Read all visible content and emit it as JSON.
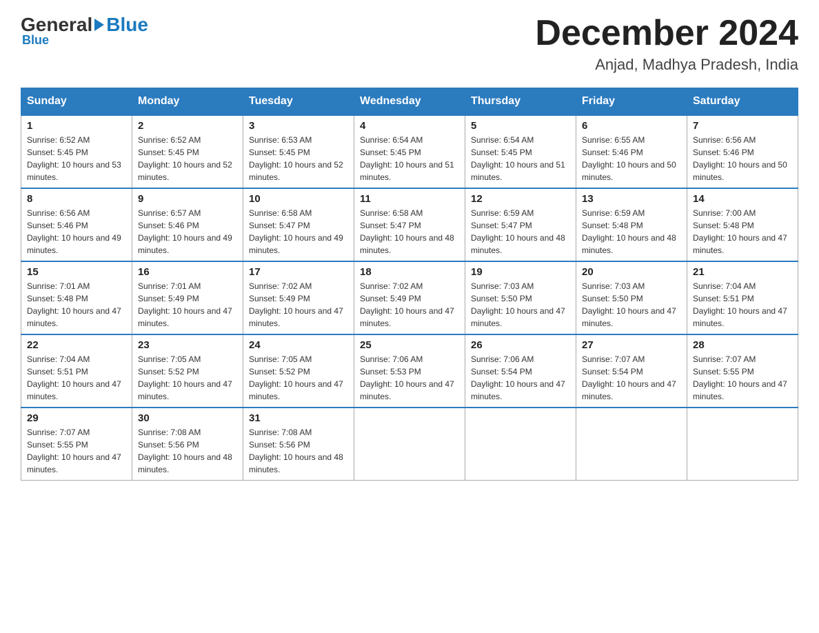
{
  "header": {
    "logo_general": "General",
    "logo_blue": "Blue",
    "calendar_title": "December 2024",
    "calendar_subtitle": "Anjad, Madhya Pradesh, India"
  },
  "weekdays": [
    "Sunday",
    "Monday",
    "Tuesday",
    "Wednesday",
    "Thursday",
    "Friday",
    "Saturday"
  ],
  "weeks": [
    [
      {
        "day": "1",
        "sunrise": "6:52 AM",
        "sunset": "5:45 PM",
        "daylight": "10 hours and 53 minutes."
      },
      {
        "day": "2",
        "sunrise": "6:52 AM",
        "sunset": "5:45 PM",
        "daylight": "10 hours and 52 minutes."
      },
      {
        "day": "3",
        "sunrise": "6:53 AM",
        "sunset": "5:45 PM",
        "daylight": "10 hours and 52 minutes."
      },
      {
        "day": "4",
        "sunrise": "6:54 AM",
        "sunset": "5:45 PM",
        "daylight": "10 hours and 51 minutes."
      },
      {
        "day": "5",
        "sunrise": "6:54 AM",
        "sunset": "5:45 PM",
        "daylight": "10 hours and 51 minutes."
      },
      {
        "day": "6",
        "sunrise": "6:55 AM",
        "sunset": "5:46 PM",
        "daylight": "10 hours and 50 minutes."
      },
      {
        "day": "7",
        "sunrise": "6:56 AM",
        "sunset": "5:46 PM",
        "daylight": "10 hours and 50 minutes."
      }
    ],
    [
      {
        "day": "8",
        "sunrise": "6:56 AM",
        "sunset": "5:46 PM",
        "daylight": "10 hours and 49 minutes."
      },
      {
        "day": "9",
        "sunrise": "6:57 AM",
        "sunset": "5:46 PM",
        "daylight": "10 hours and 49 minutes."
      },
      {
        "day": "10",
        "sunrise": "6:58 AM",
        "sunset": "5:47 PM",
        "daylight": "10 hours and 49 minutes."
      },
      {
        "day": "11",
        "sunrise": "6:58 AM",
        "sunset": "5:47 PM",
        "daylight": "10 hours and 48 minutes."
      },
      {
        "day": "12",
        "sunrise": "6:59 AM",
        "sunset": "5:47 PM",
        "daylight": "10 hours and 48 minutes."
      },
      {
        "day": "13",
        "sunrise": "6:59 AM",
        "sunset": "5:48 PM",
        "daylight": "10 hours and 48 minutes."
      },
      {
        "day": "14",
        "sunrise": "7:00 AM",
        "sunset": "5:48 PM",
        "daylight": "10 hours and 47 minutes."
      }
    ],
    [
      {
        "day": "15",
        "sunrise": "7:01 AM",
        "sunset": "5:48 PM",
        "daylight": "10 hours and 47 minutes."
      },
      {
        "day": "16",
        "sunrise": "7:01 AM",
        "sunset": "5:49 PM",
        "daylight": "10 hours and 47 minutes."
      },
      {
        "day": "17",
        "sunrise": "7:02 AM",
        "sunset": "5:49 PM",
        "daylight": "10 hours and 47 minutes."
      },
      {
        "day": "18",
        "sunrise": "7:02 AM",
        "sunset": "5:49 PM",
        "daylight": "10 hours and 47 minutes."
      },
      {
        "day": "19",
        "sunrise": "7:03 AM",
        "sunset": "5:50 PM",
        "daylight": "10 hours and 47 minutes."
      },
      {
        "day": "20",
        "sunrise": "7:03 AM",
        "sunset": "5:50 PM",
        "daylight": "10 hours and 47 minutes."
      },
      {
        "day": "21",
        "sunrise": "7:04 AM",
        "sunset": "5:51 PM",
        "daylight": "10 hours and 47 minutes."
      }
    ],
    [
      {
        "day": "22",
        "sunrise": "7:04 AM",
        "sunset": "5:51 PM",
        "daylight": "10 hours and 47 minutes."
      },
      {
        "day": "23",
        "sunrise": "7:05 AM",
        "sunset": "5:52 PM",
        "daylight": "10 hours and 47 minutes."
      },
      {
        "day": "24",
        "sunrise": "7:05 AM",
        "sunset": "5:52 PM",
        "daylight": "10 hours and 47 minutes."
      },
      {
        "day": "25",
        "sunrise": "7:06 AM",
        "sunset": "5:53 PM",
        "daylight": "10 hours and 47 minutes."
      },
      {
        "day": "26",
        "sunrise": "7:06 AM",
        "sunset": "5:54 PM",
        "daylight": "10 hours and 47 minutes."
      },
      {
        "day": "27",
        "sunrise": "7:07 AM",
        "sunset": "5:54 PM",
        "daylight": "10 hours and 47 minutes."
      },
      {
        "day": "28",
        "sunrise": "7:07 AM",
        "sunset": "5:55 PM",
        "daylight": "10 hours and 47 minutes."
      }
    ],
    [
      {
        "day": "29",
        "sunrise": "7:07 AM",
        "sunset": "5:55 PM",
        "daylight": "10 hours and 47 minutes."
      },
      {
        "day": "30",
        "sunrise": "7:08 AM",
        "sunset": "5:56 PM",
        "daylight": "10 hours and 48 minutes."
      },
      {
        "day": "31",
        "sunrise": "7:08 AM",
        "sunset": "5:56 PM",
        "daylight": "10 hours and 48 minutes."
      },
      null,
      null,
      null,
      null
    ]
  ]
}
